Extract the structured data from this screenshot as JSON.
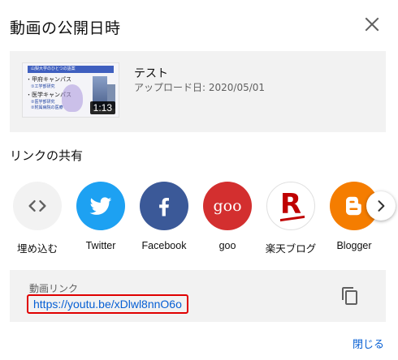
{
  "dialog": {
    "title": "動画の公開日時",
    "close_icon": "close-icon",
    "close_button_label": "閉じる"
  },
  "video": {
    "title": "テスト",
    "upload_date": "アップロード日: 2020/05/01",
    "duration": "1:13",
    "thumbnail_text": {
      "banner": "山梨大学のひとつの語案",
      "line1": "・甲府キャンパス",
      "line1_sub": "①工学部研究",
      "line2": "・医学キャンパス",
      "line2_sub1": "②医学部研究",
      "line2_sub2": "②附属病院の医療"
    }
  },
  "share": {
    "heading": "リンクの共有",
    "items": [
      {
        "label": "埋め込む",
        "icon": "embed-icon",
        "color": "#f2f2f2"
      },
      {
        "label": "Twitter",
        "icon": "twitter-icon",
        "color": "#1da1f2"
      },
      {
        "label": "Facebook",
        "icon": "facebook-icon",
        "color": "#3b5998"
      },
      {
        "label": "goo",
        "icon": "goo-icon",
        "color": "#d32f2f",
        "glyph": "goo"
      },
      {
        "label": "楽天ブログ",
        "icon": "rakuten-icon",
        "color": "#ffffff",
        "glyph": "R"
      },
      {
        "label": "Blogger",
        "icon": "blogger-icon",
        "color": "#f57d00"
      }
    ],
    "next_icon": "chevron-right-icon"
  },
  "link": {
    "label": "動画リンク",
    "url": "https://youtu.be/xDlwl8nnO6o",
    "copy_icon": "copy-icon"
  }
}
